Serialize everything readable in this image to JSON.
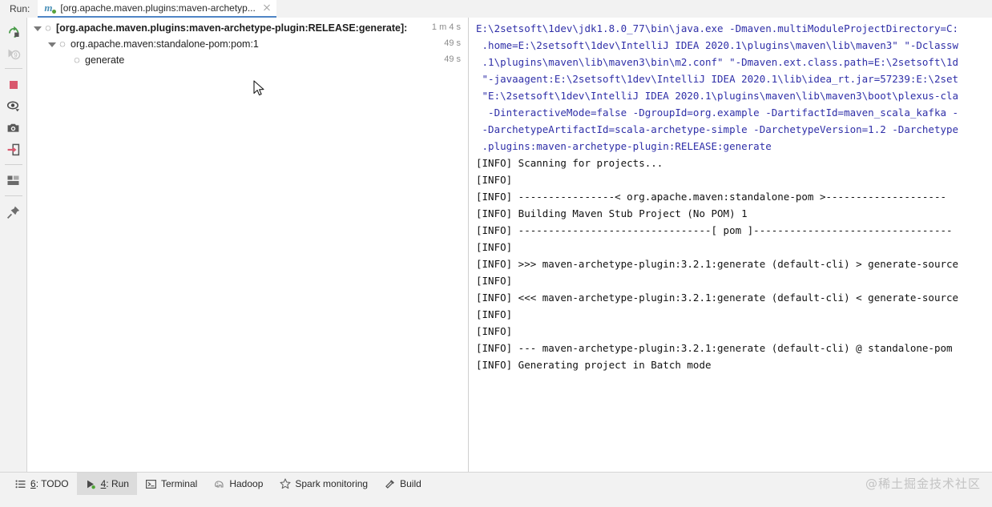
{
  "window": {
    "run_label": "Run:",
    "tab": {
      "title": "[org.apache.maven.plugins:maven-archetyp...",
      "icon": "maven-icon",
      "close_icon": "close-icon"
    }
  },
  "rail": {
    "buttons": [
      {
        "name": "rerun-icon",
        "title": "Rerun"
      },
      {
        "name": "rerun-failed-tests-icon",
        "title": "Rerun Failed Tests"
      },
      {
        "name": "stop-icon",
        "title": "Stop"
      },
      {
        "name": "toggle-auto-test-icon",
        "title": "Toggle auto-test"
      },
      {
        "name": "export-snapshot-icon",
        "title": "Export Test Results"
      },
      {
        "name": "import-results-icon",
        "title": "Import Test Results"
      },
      {
        "name": "layout-settings-icon",
        "title": "Layout Settings"
      },
      {
        "name": "pin-tab-icon",
        "title": "Pin Tab"
      }
    ]
  },
  "tree": {
    "rows": [
      {
        "label": "[org.apache.maven.plugins:maven-archetype-plugin:RELEASE:generate]:",
        "time": "1 m 4 s",
        "indent": 0,
        "bold": true,
        "expanded": true,
        "icon": "task-icon"
      },
      {
        "label": "org.apache.maven:standalone-pom:pom:1",
        "time": "49 s",
        "indent": 1,
        "bold": false,
        "expanded": true,
        "icon": "task-icon"
      },
      {
        "label": "generate",
        "time": "49 s",
        "indent": 2,
        "bold": false,
        "expanded": false,
        "icon": "task-icon"
      }
    ]
  },
  "console": {
    "lines": [
      {
        "type": "cmd",
        "text": "E:\\2setsoft\\1dev\\jdk1.8.0_77\\bin\\java.exe -Dmaven.multiModuleProjectDirectory=C:"
      },
      {
        "type": "cmd",
        "text": " .home=E:\\2setsoft\\1dev\\IntelliJ IDEA 2020.1\\plugins\\maven\\lib\\maven3\" \"-Dclassw"
      },
      {
        "type": "cmd",
        "text": " .1\\plugins\\maven\\lib\\maven3\\bin\\m2.conf\" \"-Dmaven.ext.class.path=E:\\2setsoft\\1d"
      },
      {
        "type": "cmd",
        "text": " \"-javaagent:E:\\2setsoft\\1dev\\IntelliJ IDEA 2020.1\\lib\\idea_rt.jar=57239:E:\\2set"
      },
      {
        "type": "cmd",
        "text": " \"E:\\2setsoft\\1dev\\IntelliJ IDEA 2020.1\\plugins\\maven\\lib\\maven3\\boot\\plexus-cla"
      },
      {
        "type": "cmd",
        "text": "  -DinteractiveMode=false -DgroupId=org.example -DartifactId=maven_scala_kafka -"
      },
      {
        "type": "cmd",
        "text": " -DarchetypeArtifactId=scala-archetype-simple -DarchetypeVersion=1.2 -Darchetype"
      },
      {
        "type": "cmd",
        "text": " .plugins:maven-archetype-plugin:RELEASE:generate"
      },
      {
        "type": "info",
        "text": "[INFO] Scanning for projects..."
      },
      {
        "type": "info",
        "text": "[INFO]"
      },
      {
        "type": "info",
        "text": "[INFO] ----------------< org.apache.maven:standalone-pom >--------------------"
      },
      {
        "type": "info",
        "text": "[INFO] Building Maven Stub Project (No POM) 1"
      },
      {
        "type": "info",
        "text": "[INFO] --------------------------------[ pom ]---------------------------------"
      },
      {
        "type": "info",
        "text": "[INFO]"
      },
      {
        "type": "info",
        "text": "[INFO] >>> maven-archetype-plugin:3.2.1:generate (default-cli) > generate-source"
      },
      {
        "type": "info",
        "text": "[INFO]"
      },
      {
        "type": "info",
        "text": "[INFO] <<< maven-archetype-plugin:3.2.1:generate (default-cli) < generate-source"
      },
      {
        "type": "info",
        "text": "[INFO]"
      },
      {
        "type": "info",
        "text": "[INFO]"
      },
      {
        "type": "info",
        "text": "[INFO] --- maven-archetype-plugin:3.2.1:generate (default-cli) @ standalone-pom"
      },
      {
        "type": "info",
        "text": "[INFO] Generating project in Batch mode"
      }
    ]
  },
  "statusbar": {
    "items": [
      {
        "num": "6",
        "label": ": TODO",
        "icon": "todo-list-icon",
        "active": false
      },
      {
        "num": "4",
        "label": ": Run",
        "icon": "run-play-icon",
        "active": true
      },
      {
        "num": "",
        "label": "Terminal",
        "icon": "terminal-icon",
        "active": false
      },
      {
        "num": "",
        "label": "Hadoop",
        "icon": "hadoop-elephant-icon",
        "active": false
      },
      {
        "num": "",
        "label": "Spark monitoring",
        "icon": "star-icon",
        "active": false
      },
      {
        "num": "",
        "label": "Build",
        "icon": "hammer-icon",
        "active": false
      }
    ],
    "watermark": "@稀土掘金技术社区"
  },
  "colors": {
    "tab_underline": "#4f85c5",
    "command_text": "#2f2fa8",
    "stop_red": "#d9586e",
    "rerun_green": "#4a9c4a",
    "panel_bg": "#f2f2f2",
    "console_bg": "#ffffff"
  }
}
